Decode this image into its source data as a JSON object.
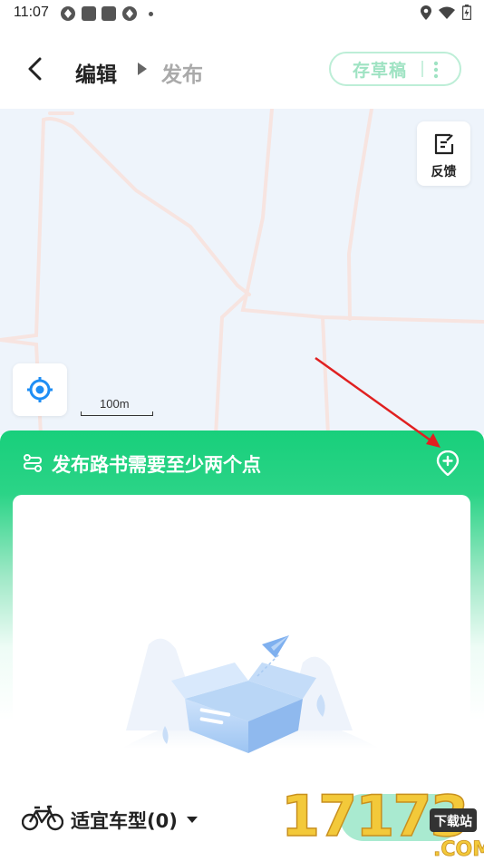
{
  "status_bar": {
    "time": "11:07"
  },
  "header": {
    "breadcrumb_edit": "编辑",
    "breadcrumb_publish": "发布",
    "draft_button": "存草稿"
  },
  "map": {
    "feedback_label": "反馈",
    "scale_label": "100m"
  },
  "panel": {
    "title": "发布路书需要至少两个点"
  },
  "bottom_bar": {
    "bike_type_label": "适宜车型(0)"
  },
  "watermark": {
    "number": "17173",
    "suffix": ".COM",
    "tag": "下载站"
  },
  "colors": {
    "accent": "#18cf7b",
    "draft_text": "#9fe3c3",
    "publish_button": "#a9ead0",
    "locate_blue": "#1e8ef5",
    "annotation_arrow": "#e02020"
  }
}
